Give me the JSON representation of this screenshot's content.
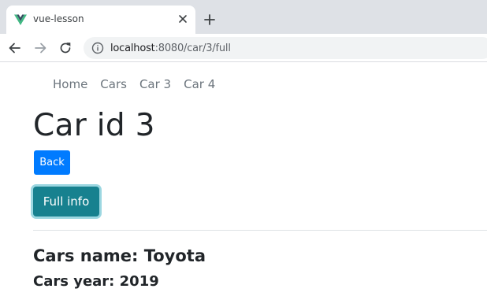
{
  "browser": {
    "tab": {
      "title": "vue-lesson",
      "favicon": "vue-logo-icon"
    },
    "address": {
      "host": "localhost",
      "path": ":8080/car/3/full"
    }
  },
  "nav": {
    "items": [
      "Home",
      "Cars",
      "Car 3",
      "Car 4"
    ]
  },
  "page": {
    "title": "Car id 3",
    "back_label": "Back",
    "full_info_label": "Full info",
    "car_name": "Cars name: Toyota",
    "car_year": "Cars year: 2019"
  },
  "colors": {
    "primary": "#007bff",
    "info_button": "#17818f",
    "vue_green": "#41b883",
    "vue_dark": "#35495e"
  }
}
